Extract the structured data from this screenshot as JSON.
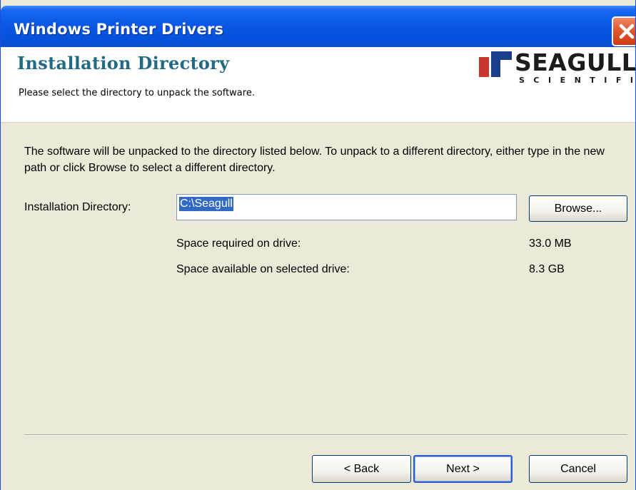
{
  "window": {
    "title": "Windows Printer Drivers"
  },
  "header": {
    "title": "Installation Directory",
    "subtitle": "Please select the directory to unpack the software.",
    "logo_word": "SEAGULL",
    "logo_sub": "SCIENTIFIC"
  },
  "main": {
    "description": "The software will be unpacked to the directory listed below.  To unpack to a different directory, either type in the new path or click Browse to select a different directory.",
    "dir_label": "Installation Directory:",
    "dir_value": "C:\\Seagull",
    "browse_label": "Browse...",
    "space_required_label": "Space required on drive:",
    "space_required_value": "33.0 MB",
    "space_available_label": "Space available on selected drive:",
    "space_available_value": "8.3 GB"
  },
  "footer": {
    "back_label": "< Back",
    "next_label": "Next >",
    "cancel_label": "Cancel"
  },
  "icons": {
    "close": "close-icon",
    "logo": "seagull-logo-icon"
  },
  "colors": {
    "titlebar": "#0a58e6",
    "header_title": "#226a84",
    "dialog_bg": "#ece9d8",
    "selection": "#316ac5",
    "close_button": "#e2582f"
  }
}
